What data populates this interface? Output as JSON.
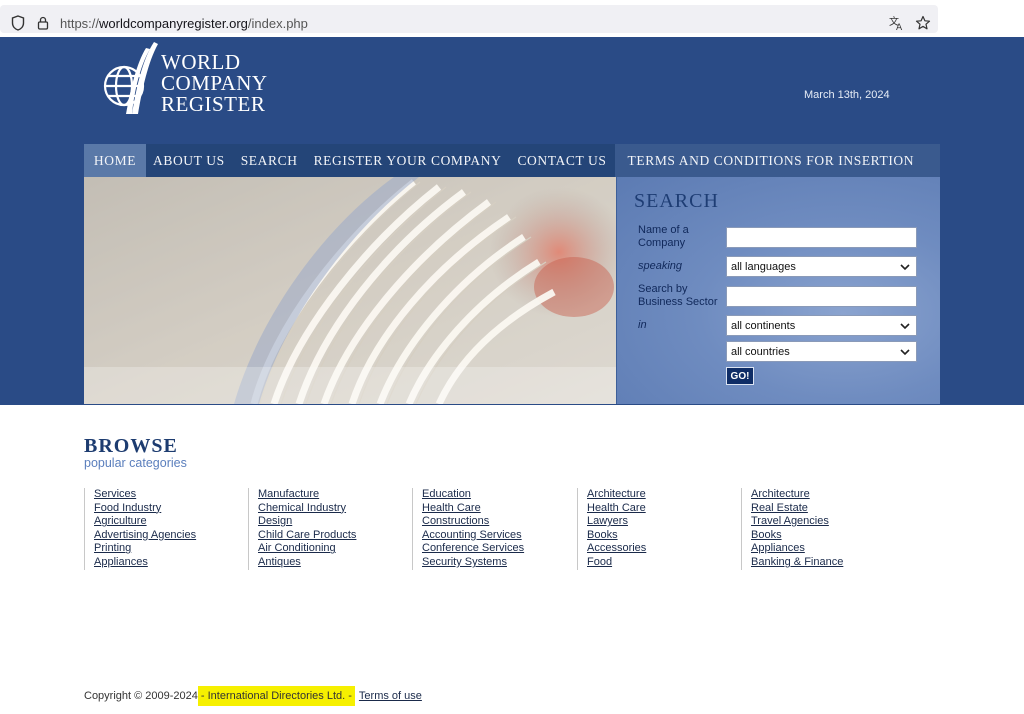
{
  "browser": {
    "url_scheme": "https://",
    "url_domain": "worldcompanyregister.org",
    "url_path": "/index.php",
    "icons": [
      "shield-icon",
      "lock-icon",
      "translate-icon",
      "star-icon"
    ]
  },
  "header": {
    "logo_line1": "WORLD",
    "logo_line2": "COMPANY",
    "logo_line3": "REGISTER",
    "date": "March 13th, 2024",
    "colors": {
      "header_bg": "#2a4b86",
      "nav_bg": "#244578",
      "nav_active": "#5a79a8"
    }
  },
  "nav": {
    "items": [
      {
        "label": "Home",
        "active": true
      },
      {
        "label": "About us",
        "active": false
      },
      {
        "label": "Search",
        "active": false
      },
      {
        "label": "Register your company",
        "active": false
      },
      {
        "label": "Contact us",
        "active": false
      },
      {
        "label": "Terms and conditions for insertion",
        "active": false
      }
    ]
  },
  "search": {
    "title": "SEARCH",
    "name_label": "Name of a Company",
    "speaking_label": "speaking",
    "language_value": "all languages",
    "sector_label": "Search by Business Sector",
    "in_label": "in",
    "continent_value": "all continents",
    "country_value": "all countries",
    "go_label": "GO!"
  },
  "browse": {
    "title": "BROWSE",
    "subtitle": "popular categories",
    "columns": [
      [
        "Services",
        "Food Industry",
        "Agriculture",
        "Advertising Agencies",
        "Printing",
        "Appliances"
      ],
      [
        "Manufacture",
        "Chemical Industry",
        "Design",
        "Child Care Products",
        "Air Conditioning",
        "Antiques"
      ],
      [
        "Education",
        "Health Care",
        "Constructions",
        "Accounting Services",
        "Conference Services",
        "Security Systems"
      ],
      [
        "Architecture",
        "Health Care",
        "Lawyers",
        "Books",
        "Accessories",
        "Food"
      ],
      [
        "Architecture",
        "Real Estate",
        "Travel Agencies",
        "Books",
        "Appliances",
        "Banking & Finance"
      ]
    ]
  },
  "footer": {
    "copyright": "Copyright © 2009-2024",
    "company": " - International Directories Ltd. - ",
    "terms": "Terms of use",
    "highlight_color": "#f6f000"
  }
}
